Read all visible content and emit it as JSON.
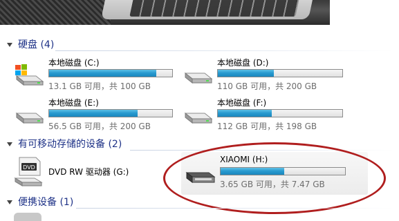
{
  "sections": {
    "hard_disks": {
      "label": "硬盘 (4)"
    },
    "removable": {
      "label": "有可移动存储的设备 (2)"
    },
    "portable": {
      "label": "便携设备 (1)"
    }
  },
  "drives": [
    {
      "name": "本地磁盘 (C:)",
      "space": "13.1 GB 可用，共 100 GB",
      "used_fraction": 0.869,
      "icon": "windows-drive-icon"
    },
    {
      "name": "本地磁盘 (D:)",
      "space": "110 GB 可用，共 200 GB",
      "used_fraction": 0.45,
      "icon": "hard-drive-icon"
    },
    {
      "name": "本地磁盘 (E:)",
      "space": "56.5 GB 可用，共 200 GB",
      "used_fraction": 0.7175,
      "icon": "hard-drive-icon"
    },
    {
      "name": "本地磁盘 (F:)",
      "space": "112 GB 可用，共 198 GB",
      "used_fraction": 0.434,
      "icon": "hard-drive-icon"
    }
  ],
  "dvd": {
    "name": "DVD RW 驱动器 (G:)",
    "icon": "dvd-drive-icon",
    "badge": "DVD"
  },
  "usb": {
    "name": "XIAOMI (H:)",
    "space": "3.65 GB 可用，共 7.47 GB",
    "used_fraction": 0.511,
    "icon": "usb-drive-icon"
  },
  "colors": {
    "section_text": "#1e3287",
    "bar_fill": "#2a9bd0",
    "annotation_circle": "#b01e1e"
  }
}
